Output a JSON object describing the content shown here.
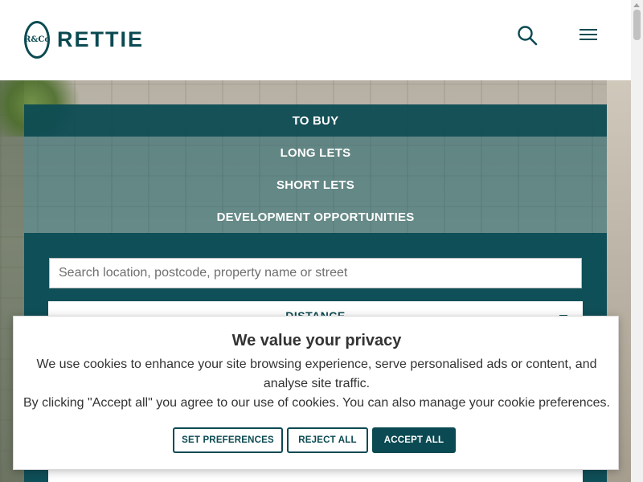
{
  "header": {
    "brand": "RETTIE",
    "logo_monogram": "R&Co",
    "icons": {
      "search": "search-icon",
      "menu": "menu-icon"
    }
  },
  "nav": {
    "items": [
      {
        "label": "TO BUY",
        "active": true
      },
      {
        "label": "LONG LETS",
        "active": false
      },
      {
        "label": "SHORT LETS",
        "active": false
      },
      {
        "label": "DEVELOPMENT OPPORTUNITIES",
        "active": false
      }
    ]
  },
  "search": {
    "placeholder": "Search location, postcode, property name or street",
    "value": "",
    "distance_label": "DISTANCE"
  },
  "cookie": {
    "title": "We value your privacy",
    "text1": "We use cookies to enhance your site browsing experience, serve personalised ads or content, and analyse site traffic.",
    "text2": "By clicking \"Accept all\" you agree to our use of cookies. You can also manage your cookie preferences.",
    "buttons": {
      "preferences": "SET PREFERENCES",
      "reject": "REJECT ALL",
      "accept": "ACCEPT ALL"
    }
  },
  "colors": {
    "brand": "#0b4a52",
    "nav_overlay": "#165c64",
    "panel": "#0f4f58"
  }
}
